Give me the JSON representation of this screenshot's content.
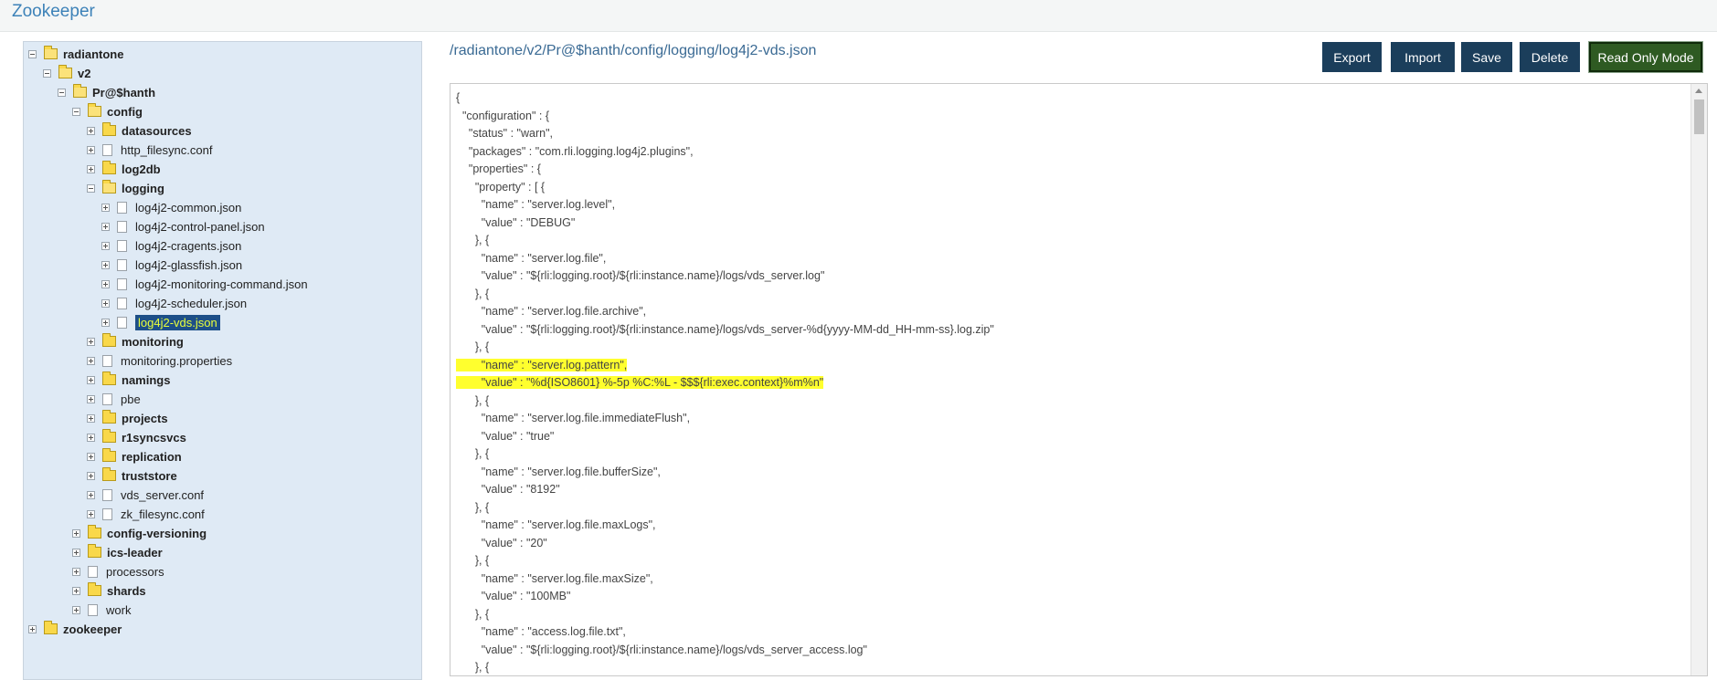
{
  "app": {
    "title": "Zookeeper"
  },
  "tree": {
    "radiantone": "radiantone",
    "v2": "v2",
    "prshanth": "Pr@$hanth",
    "config": "config",
    "datasources": "datasources",
    "http_filesync": "http_filesync.conf",
    "log2db": "log2db",
    "logging": "logging",
    "log_common": "log4j2-common.json",
    "log_control": "log4j2-control-panel.json",
    "log_cragents": "log4j2-cragents.json",
    "log_glassfish": "log4j2-glassfish.json",
    "log_monitoring_cmd": "log4j2-monitoring-command.json",
    "log_scheduler": "log4j2-scheduler.json",
    "log_vds": "log4j2-vds.json",
    "monitoring": "monitoring",
    "monitoring_props": "monitoring.properties",
    "namings": "namings",
    "pbe": "pbe",
    "projects": "projects",
    "r1syncsvcs": "r1syncsvcs",
    "replication": "replication",
    "truststore": "truststore",
    "vds_server": "vds_server.conf",
    "zk_filesync": "zk_filesync.conf",
    "config_versioning": "config-versioning",
    "ics_leader": "ics-leader",
    "processors": "processors",
    "shards": "shards",
    "work": "work",
    "zookeeper": "zookeeper"
  },
  "content": {
    "path": "/radiantone/v2/Pr@$hanth/config/logging/log4j2-vds.json",
    "buttons": {
      "export": "Export",
      "import": "Import",
      "save": "Save",
      "delete": "Delete",
      "read_only": "Read Only Mode"
    }
  },
  "editor": {
    "lines": [
      "{",
      "  \"configuration\" : {",
      "    \"status\" : \"warn\",",
      "    \"packages\" : \"com.rli.logging.log4j2.plugins\",",
      "    \"properties\" : {",
      "      \"property\" : [ {",
      "        \"name\" : \"server.log.level\",",
      "        \"value\" : \"DEBUG\"",
      "      }, {",
      "        \"name\" : \"server.log.file\",",
      "        \"value\" : \"${rli:logging.root}/${rli:instance.name}/logs/vds_server.log\"",
      "      }, {",
      "        \"name\" : \"server.log.file.archive\",",
      "        \"value\" : \"${rli:logging.root}/${rli:instance.name}/logs/vds_server-%d{yyyy-MM-dd_HH-mm-ss}.log.zip\"",
      "      }, {",
      "        \"name\" : \"server.log.pattern\",",
      "        \"value\" : \"%d{ISO8601} %-5p %C:%L - $$${rli:exec.context}%m%n\"",
      "      }, {",
      "        \"name\" : \"server.log.file.immediateFlush\",",
      "        \"value\" : \"true\"",
      "      }, {",
      "        \"name\" : \"server.log.file.bufferSize\",",
      "        \"value\" : \"8192\"",
      "      }, {",
      "        \"name\" : \"server.log.file.maxLogs\",",
      "        \"value\" : \"20\"",
      "      }, {",
      "        \"name\" : \"server.log.file.maxSize\",",
      "        \"value\" : \"100MB\"",
      "      }, {",
      "        \"name\" : \"access.log.file.txt\",",
      "        \"value\" : \"${rli:logging.root}/${rli:instance.name}/logs/vds_server_access.log\"",
      "      }, {"
    ]
  }
}
